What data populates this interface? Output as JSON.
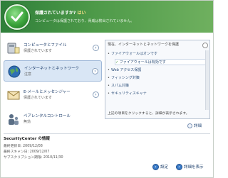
{
  "header": {
    "title": "保護されていますか?",
    "answer": "はい",
    "subtitle": "コンピュータは保護されており、脅威は検出されていません。"
  },
  "categories": [
    {
      "title": "コンピュータとファイル",
      "subtitle": "保護されています",
      "icon": "computer-files-icon"
    },
    {
      "title": "インターネットとネットワーク",
      "subtitle": "注意",
      "icon": "globe-network-icon"
    },
    {
      "title": "E-メールとメッセンジャー",
      "subtitle": "保護されています",
      "icon": "mail-messenger-icon"
    },
    {
      "title": "ペアレンタルコントロール",
      "subtitle": "無効",
      "icon": "parental-control-icon"
    }
  ],
  "panel": {
    "heading": "現在、インターネットとネットワークを保護",
    "items": [
      {
        "label": "ファイアウォールはオンです",
        "indent": false,
        "check": false
      },
      {
        "label": "ファイアウォールは有効です",
        "indent": true,
        "check": true
      },
      {
        "label": "Web アクセス保護",
        "indent": false,
        "check": false
      },
      {
        "label": "フィッシング対策",
        "indent": false,
        "check": false
      },
      {
        "label": "スパム対策",
        "indent": false,
        "check": false
      },
      {
        "label": "セキュリティスキャナ",
        "indent": false,
        "check": false
      }
    ],
    "note": "上記の項目をクリックすると、詳細が表示されます。"
  },
  "detail_button": {
    "label": "詳細"
  },
  "info": {
    "title": "SecurityCenter の情報",
    "lines": [
      "最終更新日: 2009/12/08",
      "最終スキャン日: 2009/12/07",
      "サブスクリプション期限: 2010/11/30"
    ]
  },
  "footer": {
    "settings_label": "設定",
    "details_label": "詳細を表示"
  }
}
